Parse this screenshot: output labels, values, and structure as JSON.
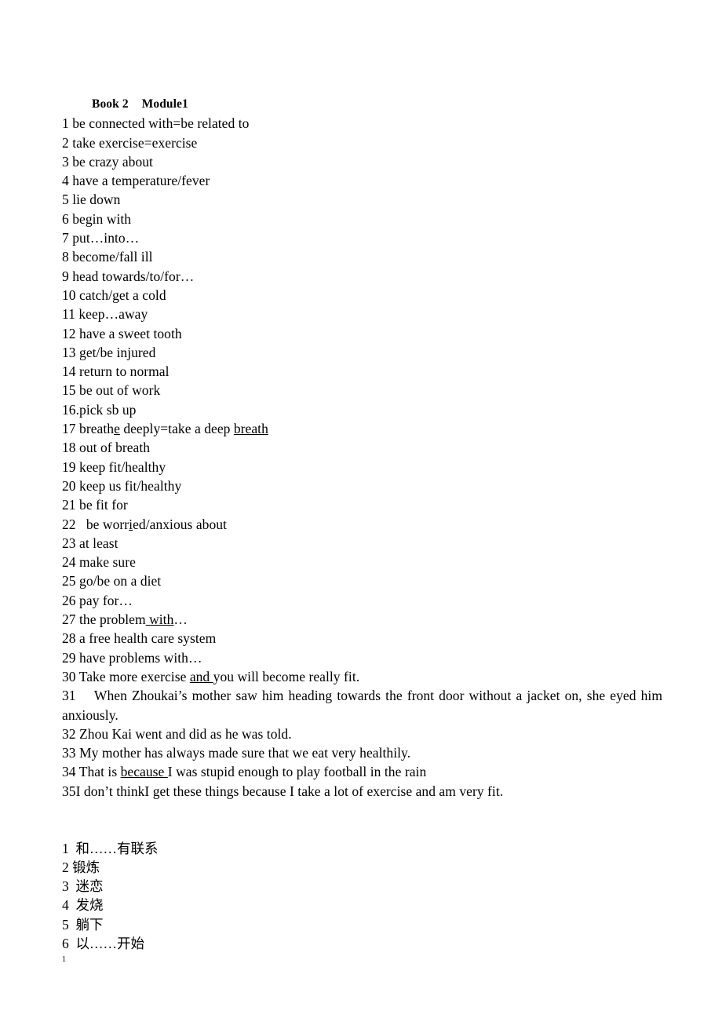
{
  "document": {
    "title": "Book 2\tModule1",
    "english_entries": [
      "1 be connected with=be related to",
      "2 take exercise=exercise",
      "3 be crazy about",
      "4 have a temperature/fever",
      "5 lie down",
      "6 begin with",
      "7 put…into…",
      "8 become/fall ill",
      "9 head towards/to/for…",
      "10 catch/get a cold",
      "11 keep…away",
      "12 have a sweet tooth",
      "13 get/be injured",
      "14 return to normal",
      "15 be out of work",
      "16.pick sb up"
    ],
    "entry_17": {
      "prefix": "17 breath",
      "underlined_e": "e",
      "middle": " deeply=take a deep ",
      "underlined_breath": "breath"
    },
    "entries_18_to_21": [
      "18 out of breath",
      "19 keep fit/healthy",
      "20 keep us fit/healthy",
      "21 be fit for"
    ],
    "entry_22": {
      "prefix": "22   be worr",
      "underlined_i": "i",
      "suffix": "ed/anxious about"
    },
    "entries_23_to_26": [
      "23 at least",
      "24 make sure",
      "25 go/be on a diet",
      "26 pay for…"
    ],
    "entry_27": {
      "prefix": "27 the problem",
      "underlined_with": " with",
      "suffix": "…"
    },
    "entries_28_29": [
      "28 a free health care system",
      "29 have problems with…"
    ],
    "entry_30": {
      "prefix": "30 Take more exercise ",
      "underlined_and": "and ",
      "suffix": "you will become really fit."
    },
    "entry_31": "31  When Zhoukai’s mother saw him heading towards the front door without a jacket on, she eyed him anxiously.",
    "entries_32_33": [
      "32 Zhou Kai went and did as he was told.",
      "33 My mother has always made sure that we eat very healthily."
    ],
    "entry_34": {
      "prefix": "34 That is ",
      "underlined_because": "because ",
      "suffix": "I was stupid enough to play football in the rain"
    },
    "entry_35": "35I don’t thinkI get these things because I take a lot of exercise and am very fit.",
    "chinese_entries": [
      "1  和……有联系",
      "2 锻炼",
      "3  迷恋",
      "4  发烧",
      "5  躺下",
      "6  以……开始"
    ],
    "page_number": "1"
  }
}
